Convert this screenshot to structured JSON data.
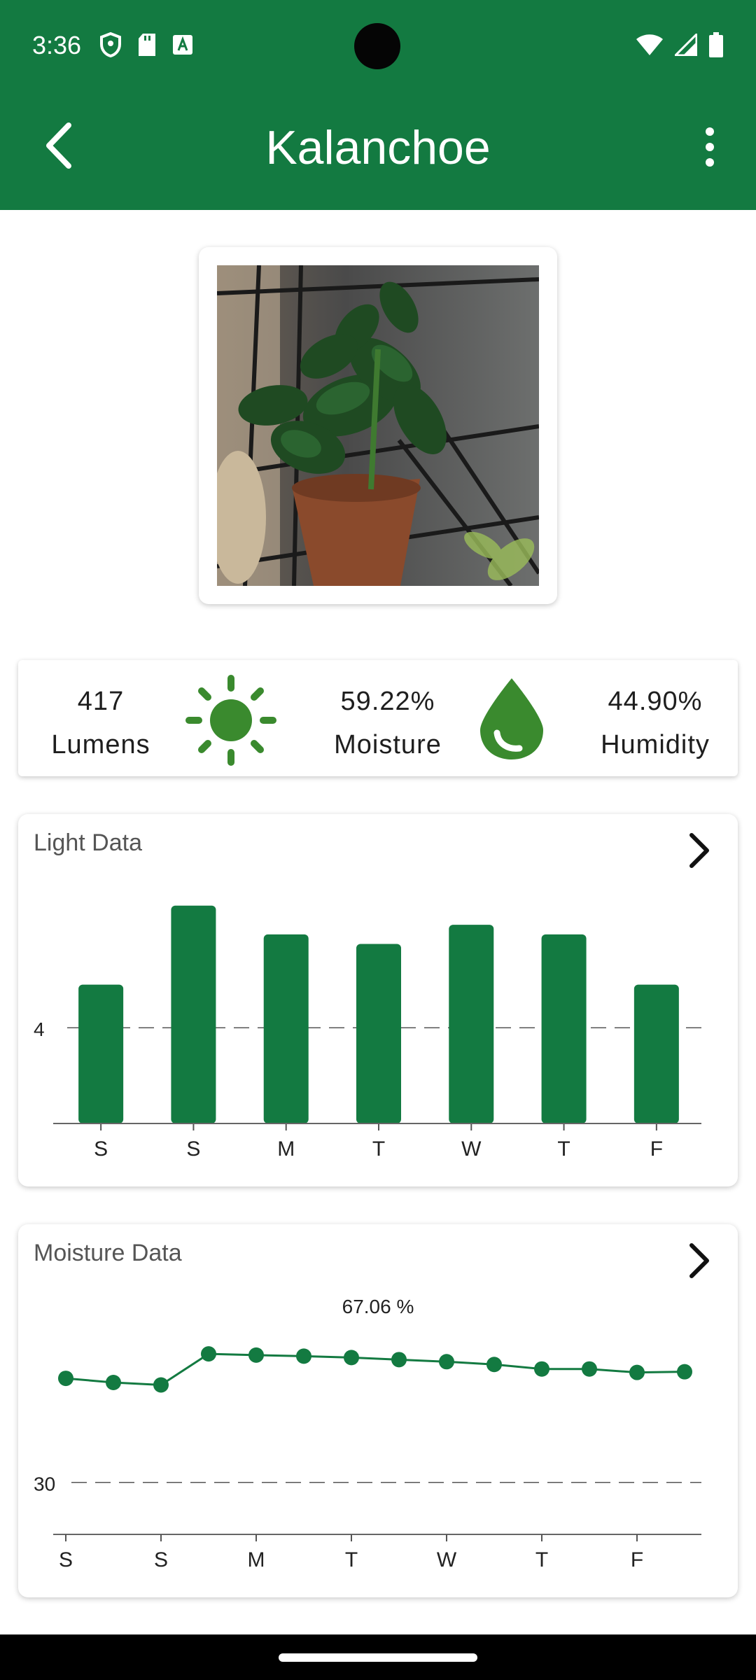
{
  "status_bar": {
    "time": "3:36",
    "icons_left": [
      "shield-icon",
      "sd-card-icon",
      "font-icon"
    ],
    "icons_right": [
      "wifi-icon",
      "signal-icon",
      "battery-icon"
    ]
  },
  "app_bar": {
    "title": "Kalanchoe",
    "back_icon": "chevron-left-icon",
    "menu_icon": "more-vert-icon"
  },
  "stats": {
    "light": {
      "value": "417",
      "label": "Lumens"
    },
    "moisture": {
      "value": "59.22%",
      "label": "Moisture"
    },
    "humidity": {
      "value": "44.90%",
      "label": "Humidity"
    },
    "sun_icon": "sun-icon",
    "drop_icon": "water-drop-icon"
  },
  "colors": {
    "brand": "#137a41",
    "icon": "#3a8a2e",
    "nav": "#000000"
  },
  "light_chart": {
    "title": "Light Data",
    "arrow_icon": "chevron-right-icon",
    "chart_data": {
      "type": "bar",
      "categories": [
        "S",
        "S",
        "M",
        "T",
        "W",
        "T",
        "F"
      ],
      "values": [
        5.8,
        9.1,
        7.9,
        7.5,
        8.3,
        7.9,
        5.8
      ],
      "ylim": [
        0,
        10
      ],
      "reference_line": {
        "value": 4,
        "label": "4",
        "style": "dashed"
      },
      "grid": false
    }
  },
  "moisture_chart": {
    "title": "Moisture Data",
    "arrow_icon": "chevron-right-icon",
    "chart_data": {
      "type": "line",
      "x_tick_labels": [
        "S",
        "S",
        "M",
        "T",
        "W",
        "T",
        "F"
      ],
      "values": [
        60.0,
        58.8,
        58.1,
        67.06,
        66.7,
        66.4,
        66.0,
        65.4,
        64.8,
        64.0,
        62.7,
        62.7,
        61.7,
        61.9
      ],
      "max_annotation": "67.06 %",
      "reference_line": {
        "value": 30,
        "label": "30",
        "style": "dashed"
      },
      "ylim": [
        15,
        80
      ],
      "grid": false
    }
  }
}
